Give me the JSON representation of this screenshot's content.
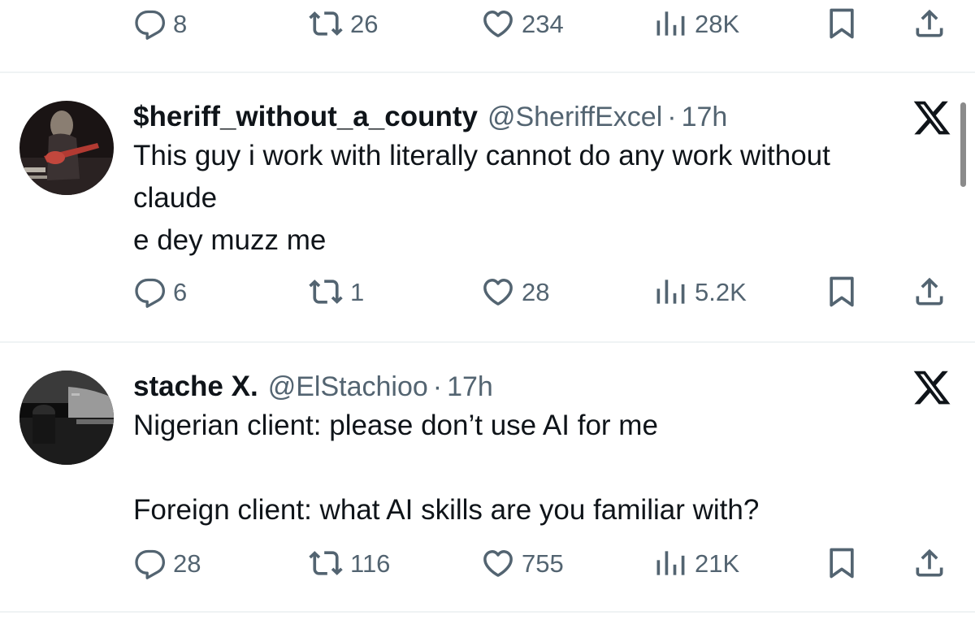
{
  "top_stats": {
    "replies": "8",
    "reposts": "26",
    "likes": "234",
    "views": "28K"
  },
  "tweets": [
    {
      "name": "$heriff_without_a_county",
      "handle": "@SheriffExcel",
      "separator": "·",
      "time": "17h",
      "text": "This guy i work with literally cannot do any work without\nclaude\ne dey muzz me",
      "stats": {
        "replies": "6",
        "reposts": "1",
        "likes": "28",
        "views": "5.2K"
      }
    },
    {
      "name": "stache X.",
      "handle": "@ElStachioo",
      "separator": "·",
      "time": "17h",
      "text": "Nigerian client: please don’t use AI for me\n\nForeign client: what AI skills are you familiar with?",
      "stats": {
        "replies": "28",
        "reposts": "116",
        "likes": "755",
        "views": "21K"
      }
    }
  ],
  "icons": {
    "reply": "reply-icon",
    "repost": "repost-icon",
    "like": "heart-icon",
    "views": "views-icon",
    "bookmark": "bookmark-icon",
    "share": "share-icon",
    "brand": "x-logo-icon"
  },
  "colors": {
    "text": "#0f1419",
    "secondary": "#536471",
    "divider": "#eff3f4"
  }
}
